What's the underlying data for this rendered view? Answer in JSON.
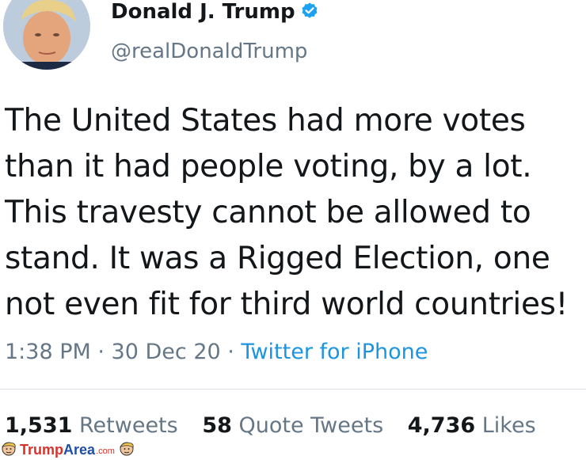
{
  "profile": {
    "display_name": "Donald J. Trump",
    "handle": "@realDonaldTrump",
    "verified_icon": "verified-badge-icon"
  },
  "tweet": {
    "lines": [
      "The United States had more votes",
      "than it had people voting, by a lot.",
      "This travesty cannot be allowed to",
      "stand. It was a Rigged Election, one",
      "not even fit for third world countries!"
    ],
    "time": "1:38 PM",
    "separator": " · ",
    "date": "30 Dec 20",
    "source": "Twitter for iPhone"
  },
  "stats": {
    "retweets_count": "1,531",
    "retweets_label": "Retweets",
    "quotes_count": "58",
    "quotes_label": "Quote Tweets",
    "likes_count": "4,736",
    "likes_label": "Likes"
  },
  "watermark": {
    "text": "TrumpArea.com"
  },
  "colors": {
    "primary_text": "#14171a",
    "secondary_text": "#657786",
    "link": "#1b95e0",
    "verified": "#1da1f2",
    "divider": "#d9dfe4"
  }
}
